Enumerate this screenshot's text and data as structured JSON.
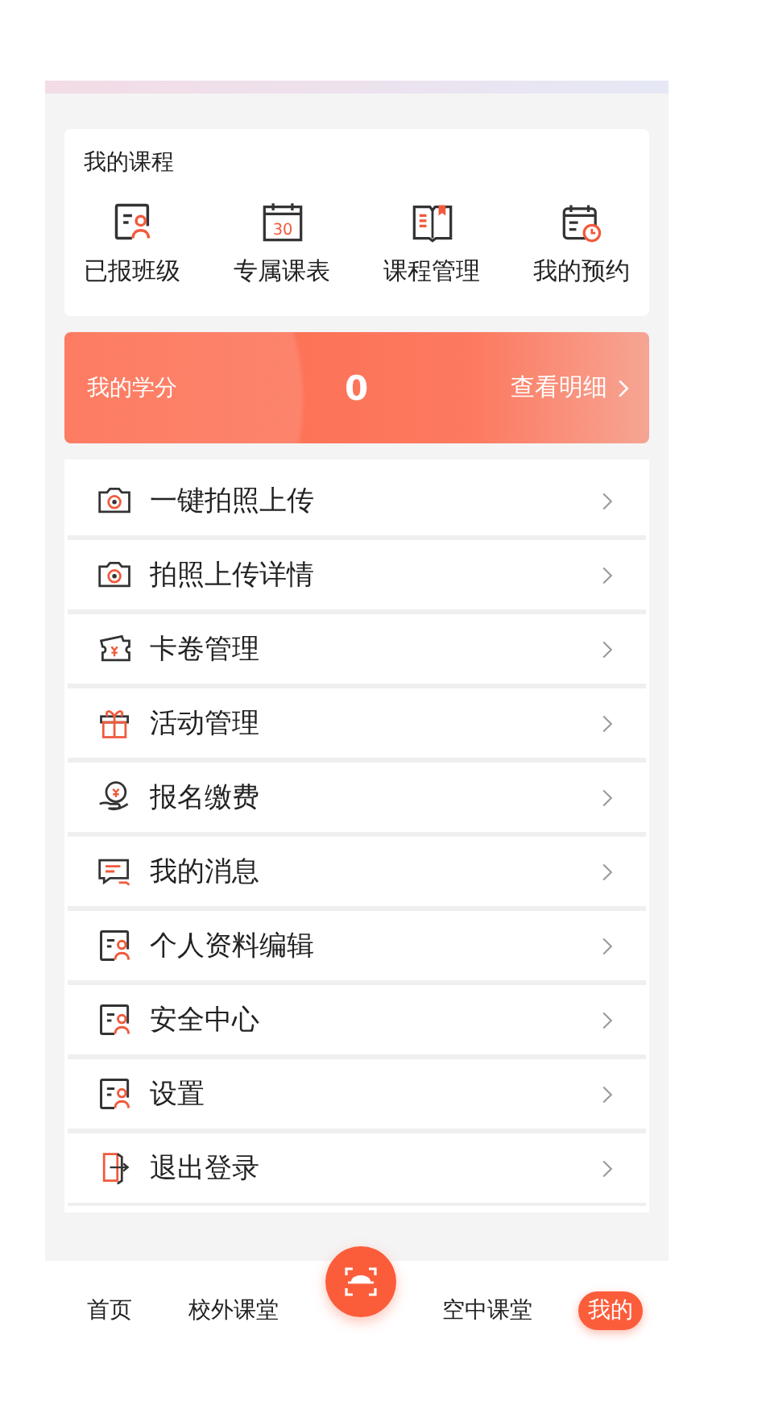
{
  "my_courses": {
    "title": "我的课程",
    "items": [
      {
        "label": "已报班级",
        "kind": "profile"
      },
      {
        "label": "专属课表",
        "kind": "calendar",
        "icon_text": "30"
      },
      {
        "label": "课程管理",
        "kind": "book"
      },
      {
        "label": "我的预约",
        "kind": "schedule"
      }
    ]
  },
  "credits": {
    "label": "我的学分",
    "value": "0",
    "link": "查看明细"
  },
  "menu": [
    {
      "label": "一键拍照上传",
      "kind": "camera"
    },
    {
      "label": "拍照上传详情",
      "kind": "camera"
    },
    {
      "label": "卡卷管理",
      "kind": "ticket"
    },
    {
      "label": "活动管理",
      "kind": "gift"
    },
    {
      "label": "报名缴费",
      "kind": "money"
    },
    {
      "label": "我的消息",
      "kind": "message"
    },
    {
      "label": "个人资料编辑",
      "kind": "profile"
    },
    {
      "label": "安全中心",
      "kind": "profile"
    },
    {
      "label": "设置",
      "kind": "profile"
    },
    {
      "label": "退出登录",
      "kind": "exit"
    }
  ],
  "tab_bar": [
    {
      "label": "首页",
      "kind": "tab",
      "selected": false
    },
    {
      "label": "校外课堂",
      "kind": "tab",
      "selected": false
    },
    {
      "kind": "scan"
    },
    {
      "label": "空中课堂",
      "kind": "tab",
      "selected": false
    },
    {
      "label": "我的",
      "kind": "tab",
      "selected": true
    }
  ]
}
